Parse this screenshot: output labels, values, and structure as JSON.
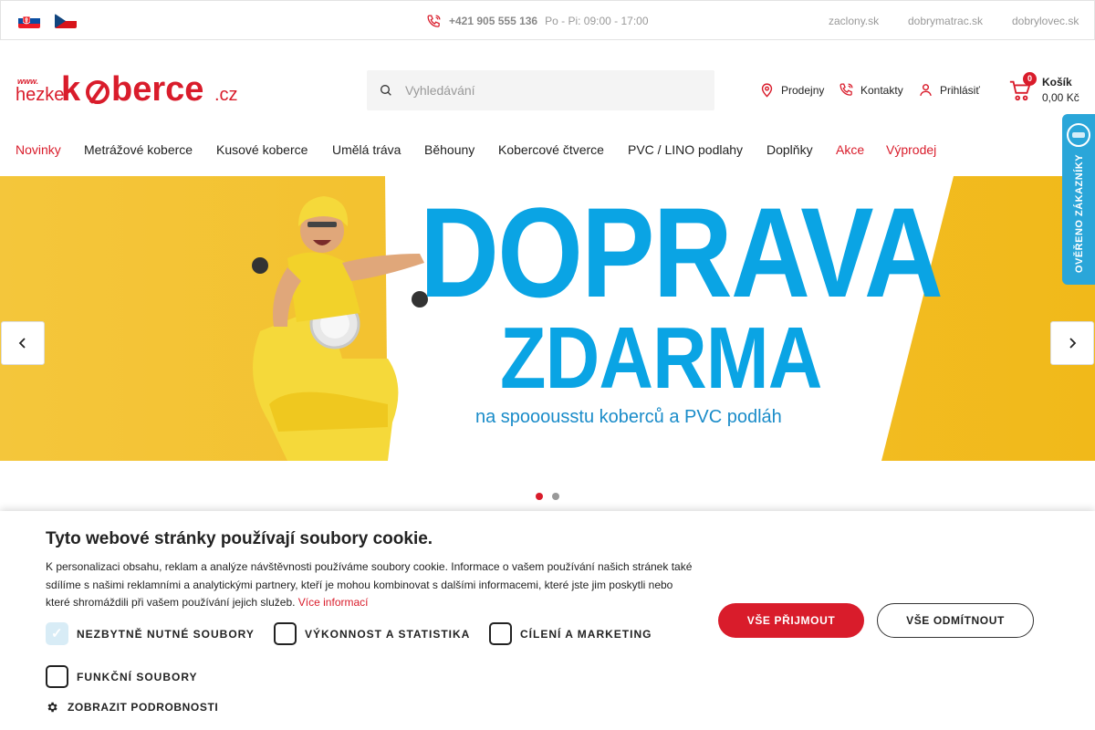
{
  "topbar": {
    "flags": [
      {
        "name": "slovakia-flag",
        "colors": [
          "#ffffff",
          "#0b4ea2",
          "#ee1c25"
        ]
      },
      {
        "name": "czech-flag",
        "colors": [
          "#ffffff",
          "#d7141a",
          "#11457e"
        ]
      }
    ],
    "phone": "+421 905 555 136",
    "hours": "Po - Pi: 09:00 - 17:00",
    "links": [
      "zaclony.sk",
      "dobrymatrac.sk",
      "dobrylovec.sk"
    ]
  },
  "header": {
    "logo": {
      "www": "www.",
      "hezke": "hezke",
      "k": "k",
      "berce": "berce",
      "cz": ".cz"
    },
    "search_placeholder": "Vyhledávání",
    "links": {
      "stores": "Prodejny",
      "contacts": "Kontakty",
      "login": "Prihlásiť"
    },
    "cart": {
      "count": "0",
      "label": "Košík",
      "amount": "0,00 Kč"
    }
  },
  "nav": {
    "items": [
      {
        "label": "Novinky",
        "highlight": true
      },
      {
        "label": "Metrážové koberce",
        "highlight": false
      },
      {
        "label": "Kusové koberce",
        "highlight": false
      },
      {
        "label": "Umělá tráva",
        "highlight": false
      },
      {
        "label": "Běhouny",
        "highlight": false
      },
      {
        "label": "Kobercové čtverce",
        "highlight": false
      },
      {
        "label": "PVC / LINO podlahy",
        "highlight": false
      },
      {
        "label": "Doplňky",
        "highlight": false
      },
      {
        "label": "Akce",
        "highlight": true
      },
      {
        "label": "Výprodej",
        "highlight": true
      }
    ]
  },
  "verified_badge": "OVĚŘENO ZÁKAZNÍKY",
  "banner": {
    "line1": "DOPRAVA",
    "line2": "ZDARMA",
    "line3": "na spooousstu koberců a PVC podláh",
    "active_slide": 1,
    "slide_count": 2
  },
  "cookie": {
    "title": "Tyto webové stránky používají soubory cookie.",
    "text": "K personalizaci obsahu, reklam a analýze návštěvnosti používáme soubory cookie. Informace o vašem používání našich stránek také sdílíme s našimi reklamními a analytickými partnery, kteří je mohou kombinovat s dalšími informacemi, které jste jim poskytli nebo které shromáždili při vašem používání jejich služeb.",
    "more_info": "Více informací",
    "options": [
      {
        "label": "NEZBYTNĚ NUTNÉ SOUBORY",
        "checked": true
      },
      {
        "label": "VÝKONNOST A STATISTIKA",
        "checked": false
      },
      {
        "label": "CÍLENÍ A MARKETING",
        "checked": false
      },
      {
        "label": "FUNKČNÍ SOUBORY",
        "checked": false
      }
    ],
    "accept": "VŠE PŘIJMOUT",
    "reject": "VŠE ODMÍTNOUT",
    "details": "ZOBRAZIT PODROBNOSTI"
  },
  "colors": {
    "brand_red": "#d91c2b",
    "banner_yellow": "#f2bf27",
    "banner_blue": "#0aa4e4"
  }
}
